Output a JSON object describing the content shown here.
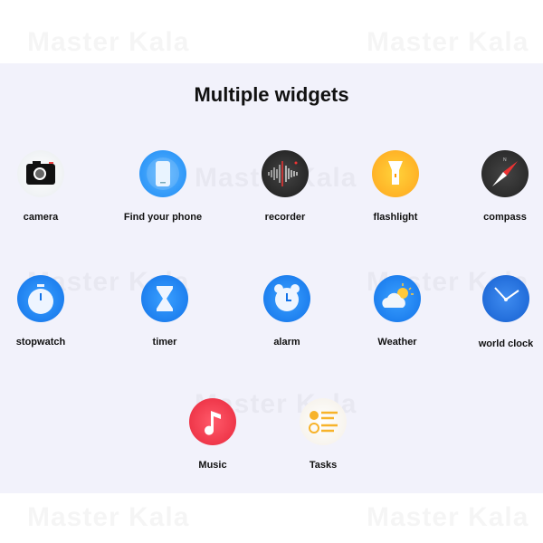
{
  "title": "Multiple widgets",
  "watermark": "Master Kala",
  "widgets": [
    {
      "label": "camera",
      "icon": "camera-icon"
    },
    {
      "label": "Find your phone",
      "icon": "phone-icon"
    },
    {
      "label": "recorder",
      "icon": "recorder-icon"
    },
    {
      "label": "flashlight",
      "icon": "flashlight-icon"
    },
    {
      "label": "compass",
      "icon": "compass-icon"
    },
    {
      "label": "stopwatch",
      "icon": "stopwatch-icon"
    },
    {
      "label": "timer",
      "icon": "hourglass-icon"
    },
    {
      "label": "alarm",
      "icon": "alarm-clock-icon"
    },
    {
      "label": "Weather",
      "icon": "weather-icon"
    },
    {
      "label": "world clock",
      "icon": "world-clock-icon"
    },
    {
      "label": "Music",
      "icon": "music-note-icon"
    },
    {
      "label": "Tasks",
      "icon": "tasks-icon"
    }
  ]
}
